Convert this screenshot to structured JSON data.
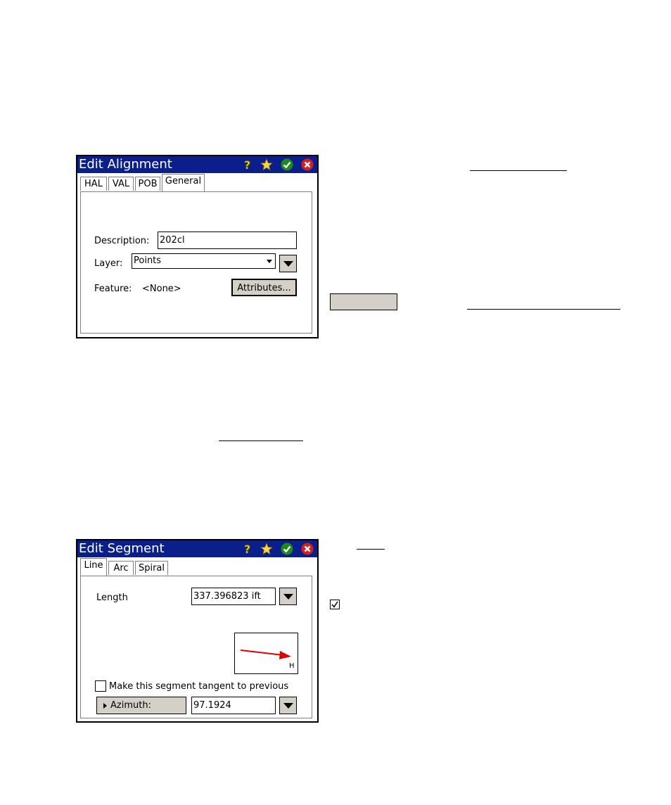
{
  "alignment_window": {
    "title": "Edit Alignment",
    "tabs": [
      "HAL",
      "VAL",
      "POB",
      "General"
    ],
    "active_tab": "General",
    "description_label": "Description:",
    "description_value": "202cl",
    "layer_label": "Layer:",
    "layer_value": "Points",
    "feature_label": "Feature:",
    "feature_value": "<None>",
    "attributes_button": "Attributes..."
  },
  "segment_window": {
    "title": "Edit Segment",
    "tabs": [
      "Line",
      "Arc",
      "Spiral"
    ],
    "active_tab": "Line",
    "length_label": "Length",
    "length_value": "337.396823 ift",
    "preview_label": "H",
    "tangent_label": "Make this segment tangent to previous",
    "tangent_checked": false,
    "azimuth_button": "Azimuth:",
    "azimuth_value": "97.1924"
  },
  "icons": [
    "help-icon",
    "favorite-icon",
    "ok-icon",
    "cancel-icon"
  ],
  "colors": {
    "titlebar": "#0b1f8c",
    "ok": "#1e8a1e",
    "cancel": "#d42020",
    "arrow": "#e00000"
  }
}
